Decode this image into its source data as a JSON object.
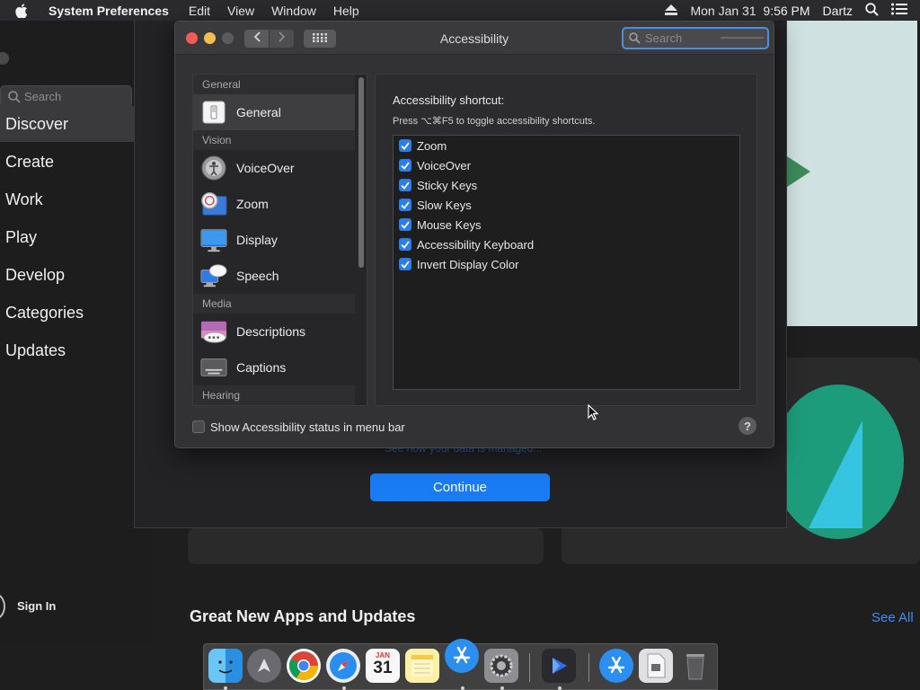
{
  "menubar": {
    "app_name": "System Preferences",
    "menus": [
      "Edit",
      "View",
      "Window",
      "Help"
    ],
    "datetime": "Mon Jan 31  9:56 PM",
    "user": "Dartz"
  },
  "appstore": {
    "search_placeholder": "Search",
    "nav": [
      "Discover",
      "Create",
      "Work",
      "Play",
      "Develop",
      "Categories",
      "Updates"
    ],
    "selected_nav": "Discover",
    "sign_in": "Sign In",
    "section_title": "Great New Apps and Updates",
    "see_all": "See All"
  },
  "sheet": {
    "link_text": "See how your data is managed...",
    "continue_label": "Continue"
  },
  "prefs": {
    "title": "Accessibility",
    "search_placeholder": "Search",
    "groups": {
      "general": "General",
      "vision": "Vision",
      "media": "Media",
      "hearing": "Hearing"
    },
    "items": {
      "general": "General",
      "voiceover": "VoiceOver",
      "zoom": "Zoom",
      "display": "Display",
      "speech": "Speech",
      "descriptions": "Descriptions",
      "captions": "Captions"
    },
    "selected_item": "General",
    "shortcut_title": "Accessibility shortcut:",
    "shortcut_desc": "Press ⌥⌘F5 to toggle accessibility shortcuts.",
    "shortcuts": [
      {
        "label": "Zoom",
        "checked": true
      },
      {
        "label": "VoiceOver",
        "checked": true
      },
      {
        "label": "Sticky Keys",
        "checked": true
      },
      {
        "label": "Slow Keys",
        "checked": true
      },
      {
        "label": "Mouse Keys",
        "checked": true
      },
      {
        "label": "Accessibility Keyboard",
        "checked": true
      },
      {
        "label": "Invert Display Color",
        "checked": true
      }
    ],
    "status_checkbox": {
      "label": "Show Accessibility status in menu bar",
      "checked": false
    },
    "help": "?"
  },
  "dock": {
    "calendar_month": "JAN",
    "calendar_day": "31"
  },
  "colors": {
    "accent": "#1a7cf5",
    "checkbox": "#2d7de8",
    "close": "#ee5e57",
    "minimize": "#f4bd4f"
  }
}
